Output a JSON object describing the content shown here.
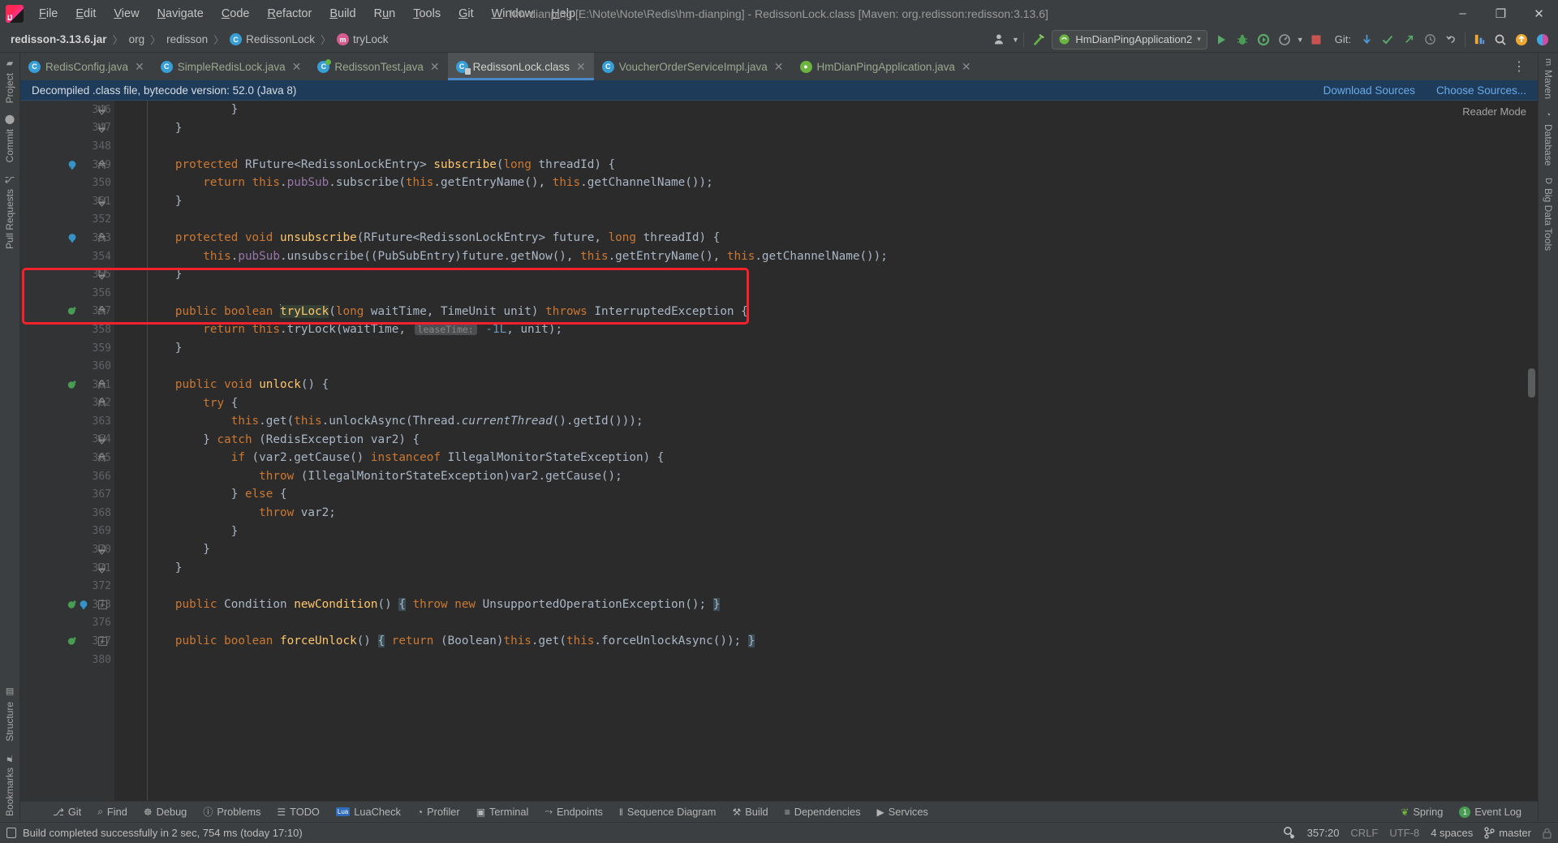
{
  "window": {
    "title": "hm-dianping [E:\\Note\\Note\\Redis\\hm-dianping] - RedissonLock.class [Maven: org.redisson:redisson:3.13.6]",
    "minimize": "–",
    "maximize": "❐",
    "close": "✕",
    "logo_text": "IJ"
  },
  "menu": [
    {
      "label": "File",
      "mnemonic": "F"
    },
    {
      "label": "Edit",
      "mnemonic": "E"
    },
    {
      "label": "View",
      "mnemonic": "V"
    },
    {
      "label": "Navigate",
      "mnemonic": "N"
    },
    {
      "label": "Code",
      "mnemonic": "C"
    },
    {
      "label": "Refactor",
      "mnemonic": "R"
    },
    {
      "label": "Build",
      "mnemonic": "B"
    },
    {
      "label": "Run",
      "mnemonic": "u"
    },
    {
      "label": "Tools",
      "mnemonic": "T"
    },
    {
      "label": "Git",
      "mnemonic": "G"
    },
    {
      "label": "Window",
      "mnemonic": "W"
    },
    {
      "label": "Help",
      "mnemonic": "H"
    }
  ],
  "breadcrumbs": [
    {
      "label": "redisson-3.13.6.jar",
      "icon": "jar-icon",
      "bold": true
    },
    {
      "label": "org",
      "icon": "package-icon",
      "bold": false
    },
    {
      "label": "redisson",
      "icon": "package-icon",
      "bold": false
    },
    {
      "label": "RedissonLock",
      "icon": "class-icon",
      "badge": "C",
      "bold": false
    },
    {
      "label": "tryLock",
      "icon": "method-icon",
      "badge": "m",
      "bold": false
    }
  ],
  "toolbar": {
    "run_config": "HmDianPingApplication2",
    "run_config_chevron": "▾",
    "git_label": "Git:",
    "icons": [
      "user-avatar-icon",
      "chevron-down-icon",
      "hammer-icon",
      "run-icon",
      "debug-icon",
      "run-with-coverage-icon",
      "profiler-icon",
      "chevron-down-icon",
      "stop-icon",
      "git-update-icon",
      "git-commit-icon",
      "git-push-icon",
      "git-history-icon",
      "git-rollback-icon",
      "layout-icon",
      "search-icon",
      "updates-icon",
      "ide-feature-icon"
    ]
  },
  "left_tool_tabs": [
    {
      "label": "Project",
      "icon": "project-folder-icon"
    },
    {
      "label": "Commit",
      "icon": "commit-icon"
    },
    {
      "label": "Pull Requests",
      "icon": "pull-request-icon"
    }
  ],
  "left_tool_tabs_bottom": [
    {
      "label": "Structure",
      "icon": "structure-icon"
    },
    {
      "label": "Bookmarks",
      "icon": "bookmark-icon"
    }
  ],
  "right_tool_tabs": [
    {
      "label": "Maven",
      "icon": "maven-icon"
    },
    {
      "label": "Database",
      "icon": "database-icon"
    },
    {
      "label": "Big Data Tools",
      "icon": "big-data-tools-icon"
    }
  ],
  "editor_tabs": [
    {
      "label": "RedisConfig.java",
      "icon": "java-class-icon",
      "active": false,
      "close": "✕"
    },
    {
      "label": "SimpleRedisLock.java",
      "icon": "java-class-icon",
      "active": false,
      "close": "✕"
    },
    {
      "label": "RedissonTest.java",
      "icon": "java-runnable-class-icon",
      "active": false,
      "close": "✕"
    },
    {
      "label": "RedissonLock.class",
      "icon": "java-decompiled-class-icon",
      "active": true,
      "close": "✕"
    },
    {
      "label": "VoucherOrderServiceImpl.java",
      "icon": "java-class-icon",
      "active": false,
      "close": "✕"
    },
    {
      "label": "HmDianPingApplication.java",
      "icon": "spring-boot-class-icon",
      "active": false,
      "close": "✕"
    }
  ],
  "tabs_overflow": "⋮",
  "notification": {
    "message": "Decompiled .class file, bytecode version: 52.0 (Java 8)",
    "actions": [
      "Download Sources",
      "Choose Sources..."
    ]
  },
  "reader_mode_label": "Reader Mode",
  "editor": {
    "first_line": 346,
    "caret_word": "tryLock",
    "param_hint": "leaseTime:",
    "lines": [
      {
        "n": 346,
        "indent": 4,
        "tokens": [
          {
            "t": "}",
            "c": "typ"
          }
        ],
        "fold": "end",
        "clipped": true
      },
      {
        "n": 347,
        "indent": 2,
        "tokens": [
          {
            "t": "}",
            "c": "typ"
          }
        ],
        "fold": "end"
      },
      {
        "n": 348,
        "indent": 0,
        "tokens": []
      },
      {
        "n": 349,
        "indent": 2,
        "run": true,
        "fold": "start",
        "tokens": [
          {
            "t": "protected ",
            "c": "kw"
          },
          {
            "t": "RFuture<RedissonLockEntry> ",
            "c": "typ"
          },
          {
            "t": "subscribe",
            "c": "mth"
          },
          {
            "t": "(",
            "c": "typ"
          },
          {
            "t": "long",
            "c": "kw"
          },
          {
            "t": " threadId) {",
            "c": "typ"
          }
        ]
      },
      {
        "n": 350,
        "indent": 3,
        "tokens": [
          {
            "t": "return ",
            "c": "kw"
          },
          {
            "t": "this",
            "c": "kw"
          },
          {
            "t": ".",
            "c": "typ"
          },
          {
            "t": "pubSub",
            "c": "fld"
          },
          {
            "t": ".subscribe(",
            "c": "typ"
          },
          {
            "t": "this",
            "c": "kw"
          },
          {
            "t": ".getEntryName(), ",
            "c": "typ"
          },
          {
            "t": "this",
            "c": "kw"
          },
          {
            "t": ".getChannelName());",
            "c": "typ"
          }
        ]
      },
      {
        "n": 351,
        "indent": 2,
        "fold": "end",
        "tokens": [
          {
            "t": "}",
            "c": "typ"
          }
        ]
      },
      {
        "n": 352,
        "indent": 0,
        "tokens": []
      },
      {
        "n": 353,
        "indent": 2,
        "run": true,
        "fold": "start",
        "tokens": [
          {
            "t": "protected ",
            "c": "kw"
          },
          {
            "t": "void ",
            "c": "kw"
          },
          {
            "t": "unsubscribe",
            "c": "mth"
          },
          {
            "t": "(RFuture<RedissonLockEntry> future, ",
            "c": "typ"
          },
          {
            "t": "long",
            "c": "kw"
          },
          {
            "t": " threadId) {",
            "c": "typ"
          }
        ]
      },
      {
        "n": 354,
        "indent": 3,
        "tokens": [
          {
            "t": "this",
            "c": "kw"
          },
          {
            "t": ".",
            "c": "typ"
          },
          {
            "t": "pubSub",
            "c": "fld"
          },
          {
            "t": ".unsubscribe((PubSubEntry)future.getNow(), ",
            "c": "typ"
          },
          {
            "t": "this",
            "c": "kw"
          },
          {
            "t": ".getEntryName(), ",
            "c": "typ"
          },
          {
            "t": "this",
            "c": "kw"
          },
          {
            "t": ".getChannelName());",
            "c": "typ"
          }
        ]
      },
      {
        "n": 355,
        "indent": 2,
        "fold": "end",
        "tokens": [
          {
            "t": "}",
            "c": "typ"
          }
        ]
      },
      {
        "n": 356,
        "indent": 0,
        "tokens": []
      },
      {
        "n": 357,
        "indent": 2,
        "override": true,
        "fold": "start",
        "highlight": true,
        "tokens": [
          {
            "t": "public ",
            "c": "kw"
          },
          {
            "t": "boolean ",
            "c": "kw"
          },
          {
            "t": "CARET",
            "c": "caret"
          },
          {
            "t": "tryLock",
            "c": "mth caretword"
          },
          {
            "t": "(",
            "c": "typ"
          },
          {
            "t": "long",
            "c": "kw"
          },
          {
            "t": " waitTime, TimeUnit unit) ",
            "c": "typ"
          },
          {
            "t": "throws ",
            "c": "kw"
          },
          {
            "t": "InterruptedException {",
            "c": "typ"
          }
        ]
      },
      {
        "n": 358,
        "indent": 3,
        "highlight": true,
        "tokens": [
          {
            "t": "return ",
            "c": "kw"
          },
          {
            "t": "this",
            "c": "kw"
          },
          {
            "t": ".tryLock(waitTime, ",
            "c": "typ"
          },
          {
            "t": "HINT",
            "c": "hint"
          },
          {
            "t": "-1L",
            "c": "num"
          },
          {
            "t": ", unit);",
            "c": "typ"
          }
        ]
      },
      {
        "n": 359,
        "indent": 2,
        "highlight": true,
        "tokens": [
          {
            "t": "}",
            "c": "typ"
          }
        ]
      },
      {
        "n": 360,
        "indent": 0,
        "tokens": []
      },
      {
        "n": 361,
        "indent": 2,
        "override": true,
        "fold": "start",
        "tokens": [
          {
            "t": "public ",
            "c": "kw"
          },
          {
            "t": "void ",
            "c": "kw"
          },
          {
            "t": "unlock",
            "c": "mth"
          },
          {
            "t": "() {",
            "c": "typ"
          }
        ]
      },
      {
        "n": 362,
        "indent": 3,
        "fold": "start",
        "tokens": [
          {
            "t": "try",
            "c": "kw"
          },
          {
            "t": " {",
            "c": "typ"
          }
        ]
      },
      {
        "n": 363,
        "indent": 4,
        "tokens": [
          {
            "t": "this",
            "c": "kw"
          },
          {
            "t": ".get(",
            "c": "typ"
          },
          {
            "t": "this",
            "c": "kw"
          },
          {
            "t": ".unlockAsync(Thread.",
            "c": "typ"
          },
          {
            "t": "currentThread",
            "c": "stat"
          },
          {
            "t": "().getId()));",
            "c": "typ"
          }
        ]
      },
      {
        "n": 364,
        "indent": 3,
        "fold": "end",
        "tokens": [
          {
            "t": "} ",
            "c": "typ"
          },
          {
            "t": "catch",
            "c": "kw"
          },
          {
            "t": " (RedisException var2) {",
            "c": "typ"
          }
        ]
      },
      {
        "n": 365,
        "indent": 4,
        "fold": "start",
        "tokens": [
          {
            "t": "if",
            "c": "kw"
          },
          {
            "t": " (var2.getCause() ",
            "c": "typ"
          },
          {
            "t": "instanceof",
            "c": "kw"
          },
          {
            "t": " IllegalMonitorStateException) {",
            "c": "typ"
          }
        ]
      },
      {
        "n": 366,
        "indent": 5,
        "tokens": [
          {
            "t": "throw",
            "c": "kw"
          },
          {
            "t": " (IllegalMonitorStateException)var2.getCause();",
            "c": "typ"
          }
        ]
      },
      {
        "n": 367,
        "indent": 4,
        "tokens": [
          {
            "t": "} ",
            "c": "typ"
          },
          {
            "t": "else",
            "c": "kw"
          },
          {
            "t": " {",
            "c": "typ"
          }
        ]
      },
      {
        "n": 368,
        "indent": 5,
        "tokens": [
          {
            "t": "throw",
            "c": "kw"
          },
          {
            "t": " var2;",
            "c": "typ"
          }
        ]
      },
      {
        "n": 369,
        "indent": 4,
        "tokens": [
          {
            "t": "}",
            "c": "typ"
          }
        ]
      },
      {
        "n": 370,
        "indent": 3,
        "fold": "end",
        "tokens": [
          {
            "t": "}",
            "c": "typ"
          }
        ]
      },
      {
        "n": 371,
        "indent": 2,
        "fold": "end",
        "tokens": [
          {
            "t": "}",
            "c": "typ"
          }
        ]
      },
      {
        "n": 372,
        "indent": 0,
        "tokens": []
      },
      {
        "n": 373,
        "indent": 2,
        "override": true,
        "run": true,
        "fold": "plus",
        "tokens": [
          {
            "t": "public ",
            "c": "kw"
          },
          {
            "t": "Condition ",
            "c": "typ"
          },
          {
            "t": "newCondition",
            "c": "mth"
          },
          {
            "t": "() ",
            "c": "typ"
          },
          {
            "t": "{",
            "c": "bracehl"
          },
          {
            "t": " ",
            "c": "typ"
          },
          {
            "t": "throw new ",
            "c": "kw"
          },
          {
            "t": "UnsupportedOperationException(); ",
            "c": "typ"
          },
          {
            "t": "}",
            "c": "bracehl"
          }
        ]
      },
      {
        "n": 376,
        "indent": 0,
        "tokens": []
      },
      {
        "n": 377,
        "indent": 2,
        "override": true,
        "fold": "plus",
        "tokens": [
          {
            "t": "public ",
            "c": "kw"
          },
          {
            "t": "boolean ",
            "c": "kw"
          },
          {
            "t": "forceUnlock",
            "c": "mth"
          },
          {
            "t": "() ",
            "c": "typ"
          },
          {
            "t": "{",
            "c": "bracehl"
          },
          {
            "t": " ",
            "c": "typ"
          },
          {
            "t": "return ",
            "c": "kw"
          },
          {
            "t": "(Boolean)",
            "c": "typ"
          },
          {
            "t": "this",
            "c": "kw"
          },
          {
            "t": ".get(",
            "c": "typ"
          },
          {
            "t": "this",
            "c": "kw"
          },
          {
            "t": ".forceUnlockAsync()); ",
            "c": "typ"
          },
          {
            "t": "}",
            "c": "bracehl"
          }
        ]
      },
      {
        "n": 380,
        "indent": 0,
        "tokens": [],
        "clipped": true
      }
    ]
  },
  "bottom_tool_window": {
    "left_items": [
      {
        "label": "Git",
        "icon": "git-branch-icon"
      },
      {
        "label": "Find",
        "icon": "search-icon"
      },
      {
        "label": "Debug",
        "icon": "bug-icon"
      },
      {
        "label": "Problems",
        "icon": "error-icon"
      },
      {
        "label": "TODO",
        "icon": "list-icon"
      },
      {
        "label": "LuaCheck",
        "icon": "lua-icon"
      },
      {
        "label": "Profiler",
        "icon": "profiler-icon"
      },
      {
        "label": "Terminal",
        "icon": "terminal-icon"
      },
      {
        "label": "Endpoints",
        "icon": "endpoints-icon"
      },
      {
        "label": "Sequence Diagram",
        "icon": "sequence-diagram-icon"
      },
      {
        "label": "Build",
        "icon": "hammer-icon"
      },
      {
        "label": "Dependencies",
        "icon": "dependencies-icon"
      },
      {
        "label": "Services",
        "icon": "services-icon"
      }
    ],
    "right_items": [
      {
        "label": "Spring",
        "icon": "spring-leaf-icon"
      },
      {
        "label": "Event Log",
        "icon": "event-log-icon",
        "badge": "1"
      }
    ]
  },
  "status_bar": {
    "message": "Build completed successfully in 2 sec, 754 ms (today 17:10)",
    "message_icon": "build-icon",
    "caret_position": "357:20",
    "line_separator": "CRLF",
    "encoding": "UTF-8",
    "indent": "4 spaces",
    "branch": "master",
    "branch_icon": "git-branch-icon",
    "inspection_icon": "inspections-icon",
    "lock_icon": "read-only-icon"
  },
  "colors": {
    "accent_blue": "#4a88c7",
    "notification_bg": "#1e3c5a",
    "highlight_red": "#f5222d",
    "editor_bg": "#2b2b2b",
    "gutter_bg": "#313335",
    "chrome_bg": "#3c3f41",
    "keyword": "#cc7832",
    "method": "#ffc66d",
    "field": "#9876aa",
    "number": "#6897bb",
    "text": "#a9b7c6"
  }
}
